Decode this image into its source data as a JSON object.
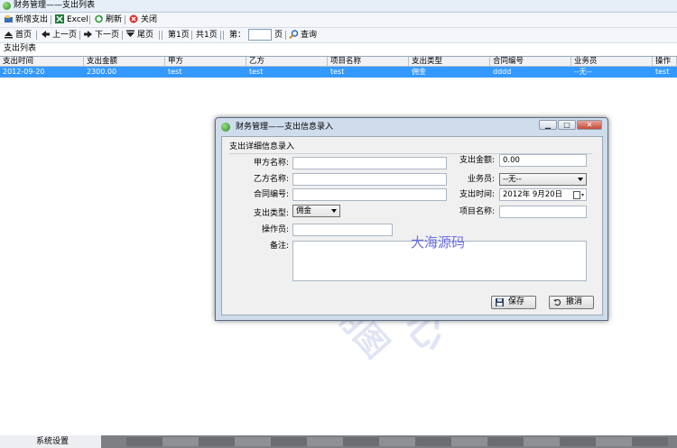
{
  "window": {
    "title": "财务管理——支出列表"
  },
  "toolbar1": {
    "new_label": "新增支出",
    "excel_label": "Excel",
    "refresh_label": "刷新",
    "close_label": "关闭"
  },
  "toolbar2": {
    "first_label": "首页",
    "prev_label": "上一页",
    "next_label": "下一页",
    "last_label": "尾页",
    "current_page": "第1页",
    "total_pages": "共1页",
    "goto_prefix": "第：",
    "goto_value": "",
    "goto_suffix": "页",
    "query_label": "查询"
  },
  "list": {
    "label": "支出列表",
    "columns": [
      "支出时间",
      "支出金额",
      "甲方",
      "乙方",
      "项目名称",
      "支出类型",
      "合同编号",
      "业务员",
      "操作员"
    ],
    "rows": [
      [
        "2012-09-20",
        "2300.00",
        "test",
        "test",
        "test",
        "佣金",
        "dddd",
        "--无--",
        "test"
      ]
    ]
  },
  "statusbar": {
    "tab_label": "系统设置"
  },
  "dialog": {
    "title": "财务管理——支出信息录入",
    "section_label": "支出详细信息录入",
    "fields": {
      "party_a_label": "甲方名称:",
      "party_a_value": "",
      "party_b_label": "乙方名称:",
      "party_b_value": "",
      "contract_label": "合同编号:",
      "contract_value": "",
      "type_label": "支出类型:",
      "type_value": "佣金",
      "operator_label": "操作员:",
      "operator_value": "",
      "remark_label": "备注:",
      "remark_value": "",
      "amount_label": "支出金额:",
      "amount_value": "0.00",
      "salesman_label": "业务员:",
      "salesman_value": "--无--",
      "date_label": "支出时间:",
      "date_value": "2012年 9月20日",
      "project_label": "项目名称:",
      "project_value": ""
    },
    "save_label": "保存",
    "cancel_label": "撤消"
  },
  "watermark": {
    "text_overlay": "大海源码",
    "text_diagonal_1": "大海源码中心",
    "text_diagonal_2": "商业站点专用图"
  },
  "colors": {
    "selection": "#3399ff",
    "dialog_frame": "#cfdcec"
  }
}
